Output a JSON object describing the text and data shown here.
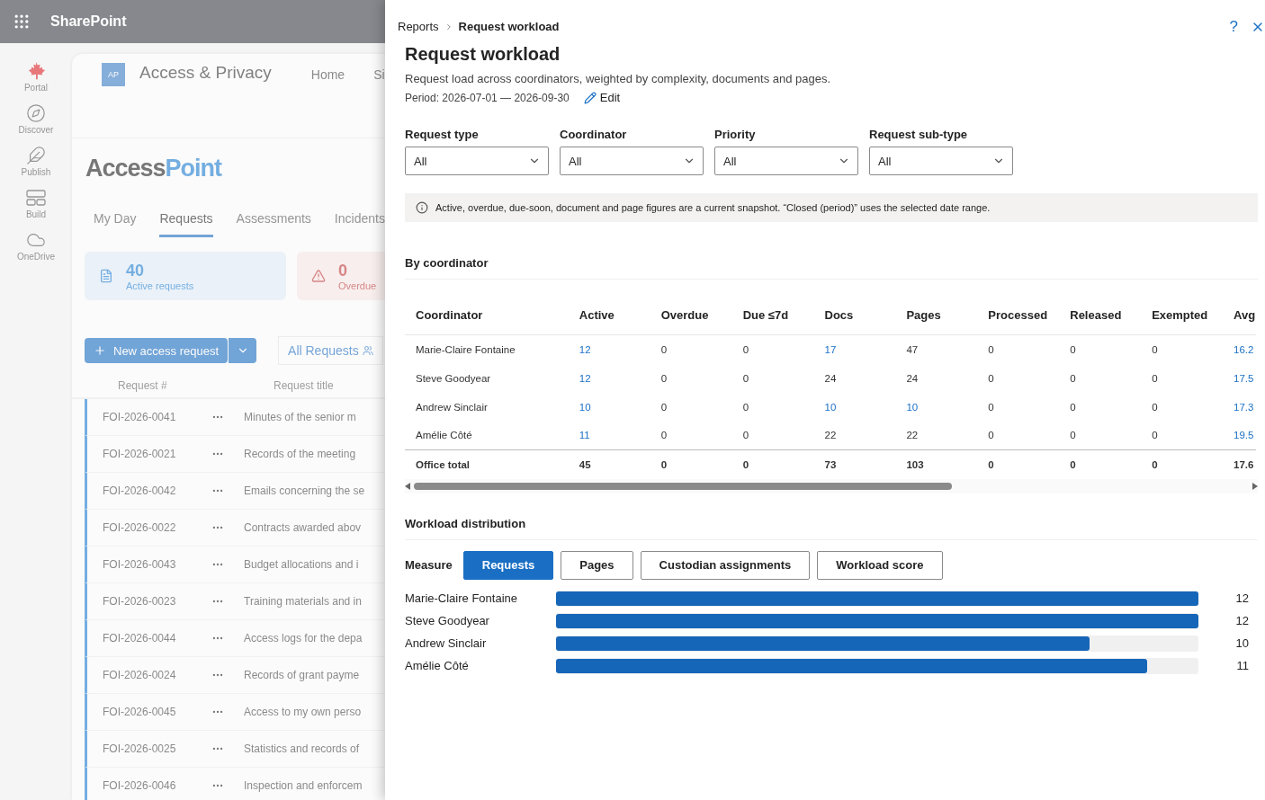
{
  "suite_bar": {
    "title": "SharePoint"
  },
  "app_rail": [
    {
      "label": "Portal",
      "kind": "leaf"
    },
    {
      "label": "Discover",
      "kind": "compass"
    },
    {
      "label": "Publish",
      "kind": "pen"
    },
    {
      "label": "Build",
      "kind": "build"
    },
    {
      "label": "OneDrive",
      "kind": "cloud"
    }
  ],
  "site": {
    "logo": "AP",
    "title": "Access & Privacy",
    "nav": [
      "Home",
      "Si"
    ],
    "brand_left": "Access",
    "brand_right": "Point",
    "tabs": [
      {
        "label": "My Day",
        "selected": false
      },
      {
        "label": "Requests",
        "selected": true
      },
      {
        "label": "Assessments",
        "selected": false
      },
      {
        "label": "Incidents",
        "selected": false
      }
    ],
    "stats": [
      {
        "value": "40",
        "label": "Active requests",
        "kind": "info"
      },
      {
        "value": "0",
        "label": "Overdue",
        "kind": "alert"
      }
    ],
    "new_button": "New access request",
    "view_button": "All Requests",
    "list_columns": [
      "Request #",
      "Request title"
    ],
    "list_rows": [
      {
        "id": "FOI-2026-0041",
        "title": "Minutes of the senior m"
      },
      {
        "id": "FOI-2026-0021",
        "title": "Records of the meeting"
      },
      {
        "id": "FOI-2026-0042",
        "title": "Emails concerning the se"
      },
      {
        "id": "FOI-2026-0022",
        "title": "Contracts awarded abov"
      },
      {
        "id": "FOI-2026-0043",
        "title": "Budget allocations and i"
      },
      {
        "id": "FOI-2026-0023",
        "title": "Training materials and in"
      },
      {
        "id": "FOI-2026-0044",
        "title": "Access logs for the depa"
      },
      {
        "id": "FOI-2026-0024",
        "title": "Records of grant payme"
      },
      {
        "id": "FOI-2026-0045",
        "title": "Access to my own perso"
      },
      {
        "id": "FOI-2026-0025",
        "title": "Statistics and records of"
      },
      {
        "id": "FOI-2026-0046",
        "title": "Inspection and enforcem"
      }
    ]
  },
  "panel": {
    "breadcrumb": [
      "Reports",
      "Request workload"
    ],
    "help": "?",
    "title": "Request workload",
    "description": "Request load across coordinators, weighted by complexity, documents and pages.",
    "period": "Period: 2026-07-01 — 2026-09-30",
    "edit": "Edit",
    "filters": [
      {
        "label": "Request type",
        "value": "All"
      },
      {
        "label": "Coordinator",
        "value": "All"
      },
      {
        "label": "Priority",
        "value": "All"
      },
      {
        "label": "Request sub-type",
        "value": "All"
      }
    ],
    "notice": "Active, overdue, due-soon, document and page figures are a current snapshot. “Closed (period)” uses the selected date range.",
    "table_title": "By coordinator",
    "columns": [
      "Coordinator",
      "Active",
      "Overdue",
      "Due ≤7d",
      "Docs",
      "Pages",
      "Processed",
      "Released",
      "Exempted",
      "Avg"
    ],
    "rows": [
      {
        "cells": [
          {
            "text": "Marie-Claire Fontaine",
            "link": false
          },
          {
            "text": "12",
            "link": true
          },
          {
            "text": "0",
            "link": false
          },
          {
            "text": "0",
            "link": false
          },
          {
            "text": "17",
            "link": true
          },
          {
            "text": "47",
            "link": false
          },
          {
            "text": "0",
            "link": false
          },
          {
            "text": "0",
            "link": false
          },
          {
            "text": "0",
            "link": false
          },
          {
            "text": "16.2",
            "link": true
          }
        ]
      },
      {
        "cells": [
          {
            "text": "Steve Goodyear",
            "link": false
          },
          {
            "text": "12",
            "link": true
          },
          {
            "text": "0",
            "link": false
          },
          {
            "text": "0",
            "link": false
          },
          {
            "text": "24",
            "link": false
          },
          {
            "text": "24",
            "link": false
          },
          {
            "text": "0",
            "link": false
          },
          {
            "text": "0",
            "link": false
          },
          {
            "text": "0",
            "link": false
          },
          {
            "text": "17.5",
            "link": true
          }
        ]
      },
      {
        "cells": [
          {
            "text": "Andrew Sinclair",
            "link": false
          },
          {
            "text": "10",
            "link": true
          },
          {
            "text": "0",
            "link": false
          },
          {
            "text": "0",
            "link": false
          },
          {
            "text": "10",
            "link": true
          },
          {
            "text": "10",
            "link": true
          },
          {
            "text": "0",
            "link": false
          },
          {
            "text": "0",
            "link": false
          },
          {
            "text": "0",
            "link": false
          },
          {
            "text": "17.3",
            "link": true
          }
        ]
      },
      {
        "cells": [
          {
            "text": "Amélie Côté",
            "link": false
          },
          {
            "text": "11",
            "link": true
          },
          {
            "text": "0",
            "link": false
          },
          {
            "text": "0",
            "link": false
          },
          {
            "text": "22",
            "link": false
          },
          {
            "text": "22",
            "link": false
          },
          {
            "text": "0",
            "link": false
          },
          {
            "text": "0",
            "link": false
          },
          {
            "text": "0",
            "link": false
          },
          {
            "text": "19.5",
            "link": true
          }
        ]
      }
    ],
    "total": [
      "Office total",
      "45",
      "0",
      "0",
      "73",
      "103",
      "0",
      "0",
      "0",
      "17.6"
    ],
    "dist_title": "Workload distribution",
    "measure_label": "Measure",
    "measures": [
      {
        "label": "Requests",
        "selected": true
      },
      {
        "label": "Pages",
        "selected": false
      },
      {
        "label": "Custodian assignments",
        "selected": false
      },
      {
        "label": "Workload score",
        "selected": false
      }
    ],
    "bars": [
      {
        "name": "Marie-Claire Fontaine",
        "level": 1,
        "value": "12"
      },
      {
        "name": "Steve Goodyear",
        "level": 1,
        "value": "12"
      },
      {
        "name": "Andrew Sinclair",
        "level": 0.83,
        "value": "10"
      },
      {
        "name": "Amélie Côté",
        "level": 0.92,
        "value": "11"
      }
    ]
  }
}
